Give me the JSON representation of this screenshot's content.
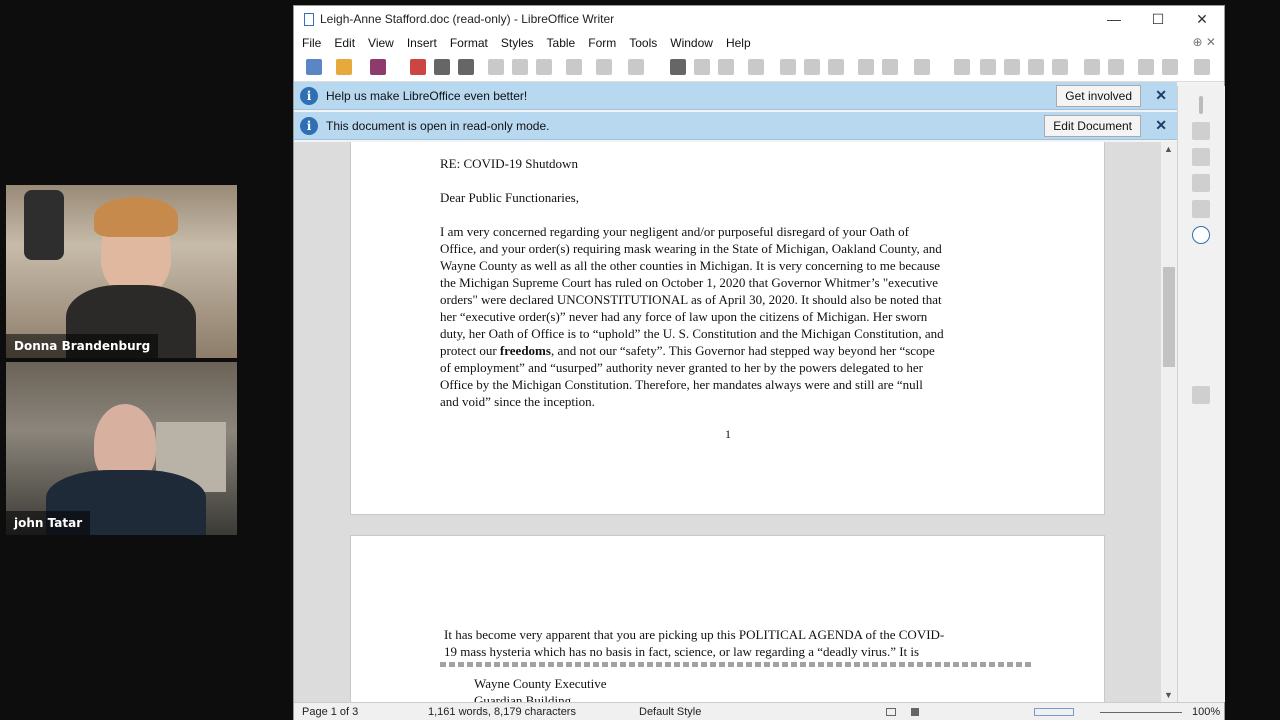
{
  "participants": [
    {
      "name": "Donna Brandenburg"
    },
    {
      "name": "john Tatar"
    }
  ],
  "window": {
    "title": "Leigh-Anne Stafford.doc (read-only) - LibreOffice Writer",
    "controls": {
      "minimize": "—",
      "maximize": "☐",
      "close": "✕"
    }
  },
  "menu": [
    "File",
    "Edit",
    "View",
    "Insert",
    "Format",
    "Styles",
    "Table",
    "Form",
    "Tools",
    "Window",
    "Help"
  ],
  "infobars": {
    "improve": {
      "message": "Help us make LibreOffice even better!",
      "button": "Get involved",
      "close": "✕"
    },
    "readonly": {
      "message": "This document is open in read-only mode.",
      "button": "Edit Document",
      "close": "✕"
    }
  },
  "document": {
    "page1": {
      "re_line": "RE:  COVID-19 Shutdown",
      "salutation": "Dear Public Functionaries,",
      "body_lines": [
        "I am very concerned regarding your negligent and/or purposeful disregard of your Oath of",
        "Office, and your order(s) requiring mask wearing in the State of Michigan,  Oakland County, and",
        "Wayne County as well as all the other counties in Michigan.  It is very concerning to me because",
        "the Michigan Supreme Court has ruled on October 1, 2020 that Governor Whitmer’s \"executive",
        "orders\" were declared UNCONSTITUTIONAL as of April 30, 2020.  It should also be noted that",
        "her “executive order(s)” never had any force of law upon the citizens of Michigan.  Her sworn",
        "duty, her Oath of Office is to “uphold” the U. S. Constitution and the Michigan Constitution, and"
      ],
      "line8_pre": "protect our ",
      "line8_bold": "freedoms",
      "line8_post": ", and not our “safety”.  This Governor had stepped way beyond her “scope",
      "body_lines_end": [
        "of employment” and “usurped” authority never granted to her by the powers delegated to her",
        "Office by the Michigan Constitution.  Therefore, her mandates always were and still are “null",
        "and void” since the inception."
      ],
      "page_number": "1"
    },
    "page2": {
      "body_lines": [
        "It has become very apparent that you are picking up this POLITICAL AGENDA of the COVID-",
        "19 mass hysteria which has no basis in fact, science, or law regarding a “deadly virus.” It is"
      ],
      "address_lines": [
        "Wayne County Executive",
        "Guardian Building"
      ]
    }
  },
  "status": {
    "page": "Page 1 of 3",
    "words": "1,161 words, 8,179 characters",
    "style": "Default Style",
    "zoom": "100%"
  }
}
